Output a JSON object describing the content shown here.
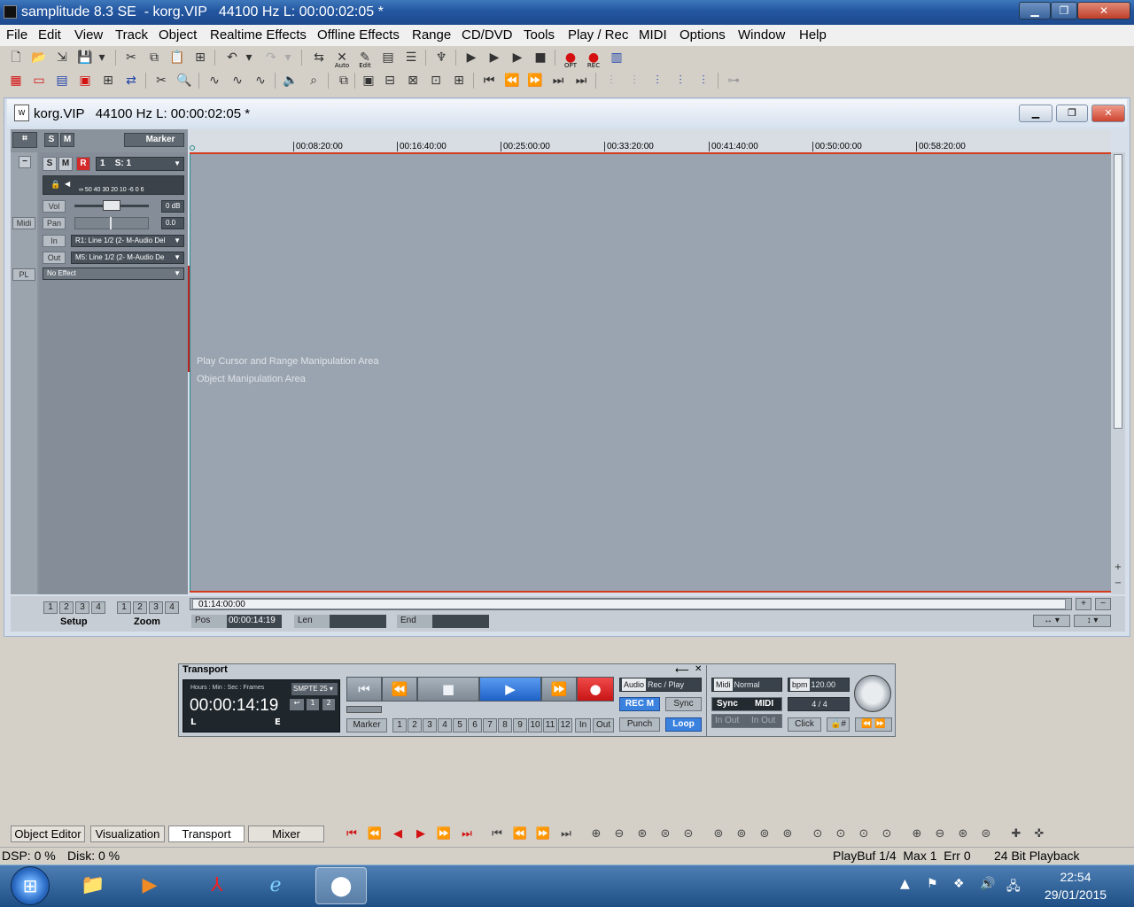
{
  "window": {
    "title": "samplitude 8.3 SE  - korg.VIP   44100 Hz L: 00:00:02:05 *"
  },
  "menu": [
    "File",
    "Edit",
    "View",
    "Track",
    "Object",
    "Realtime Effects",
    "Offline Effects",
    "Range",
    "CD/DVD",
    "Tools",
    "Play / Rec",
    "MIDI",
    "Options",
    "Window",
    "Help"
  ],
  "toolbar1": {
    "auto_label": "Auto",
    "edit_label": "Edit",
    "opt_label": "OPT",
    "rec_label": "REC"
  },
  "document": {
    "title": "korg.VIP   44100 Hz L: 00:00:02:05 *",
    "icon_text": "W"
  },
  "track_header": {
    "s": "S",
    "m": "M",
    "marker": "Marker"
  },
  "track": {
    "s": "S",
    "m": "M",
    "r": "R",
    "number": "1",
    "name": "S: 1",
    "meter_scale": "∞  50 40 30 20  10 -6  0  6",
    "vol_label": "Vol",
    "vol_value": "0 dB",
    "midi_label": "Midi",
    "pan_label": "Pan",
    "pan_value": "0.0",
    "in_label": "In",
    "in_value": "R1: Line 1/2 (2- M-Audio Del",
    "out_label": "Out",
    "out_value": "M5: Line 1/2 (2- M-Audio De",
    "pl_label": "PL",
    "effect_value": "No Effect",
    "minus": "−"
  },
  "ruler": {
    "ticks": [
      "00:08:20:00",
      "00:16:40:00",
      "00:25:00:00",
      "00:33:20:00",
      "00:41:40:00",
      "00:50:00:00",
      "00:58:20:00"
    ]
  },
  "edit_area": {
    "play_cursor_text": "Play Cursor and Range Manipulation Area",
    "object_text": "Object Manipulation Area"
  },
  "bottom": {
    "setup_buttons": [
      "1",
      "2",
      "3",
      "4"
    ],
    "zoom_buttons": [
      "1",
      "2",
      "3",
      "4"
    ],
    "setup_label": "Setup",
    "zoom_label": "Zoom",
    "hscroll_value": "01:14:00:00",
    "pos_label": "Pos",
    "pos_value": "00:00:14:19",
    "len_label": "Len",
    "len_value": "",
    "end_label": "End",
    "end_value": "",
    "plus": "+",
    "minus": "−"
  },
  "transport": {
    "title": "Transport",
    "tc_format": "Hours : Min : Sec : Frames",
    "smpte": "SMPTE 25",
    "time": "00:00:14:19",
    "l": "L",
    "e": "E",
    "audio_label": "Audio",
    "rec_play": "Rec / Play",
    "rec_m": "REC M",
    "sync": "Sync",
    "marker": "Marker",
    "markers": [
      "1",
      "2",
      "3",
      "4",
      "5",
      "6",
      "7",
      "8",
      "9",
      "10",
      "11",
      "12",
      "In",
      "Out"
    ],
    "punch": "Punch",
    "loop": "Loop",
    "midi_label": "Midi",
    "midi_mode": "Normal",
    "sync_label": "Sync",
    "midi_btn": "MIDI",
    "in_out1": "In Out",
    "in_out2": "In Out",
    "bpm_label": "bpm",
    "bpm_value": "120.00",
    "sig": "4 / 4",
    "click": "Click"
  },
  "tabs": [
    "Object Editor",
    "Visualization",
    "Transport",
    "Mixer"
  ],
  "status": {
    "dsp": "DSP: 0 %",
    "disk": "Disk: 0 %",
    "playbuf": "PlayBuf 1/4  Max 1  Err 0",
    "bit": "24 Bit Playback"
  },
  "clock": {
    "time": "22:54",
    "date": "29/01/2015"
  },
  "colors": {
    "accent_blue": "#1f62c8",
    "record_red": "#d52a2a",
    "range_line": "#d33b1d"
  }
}
